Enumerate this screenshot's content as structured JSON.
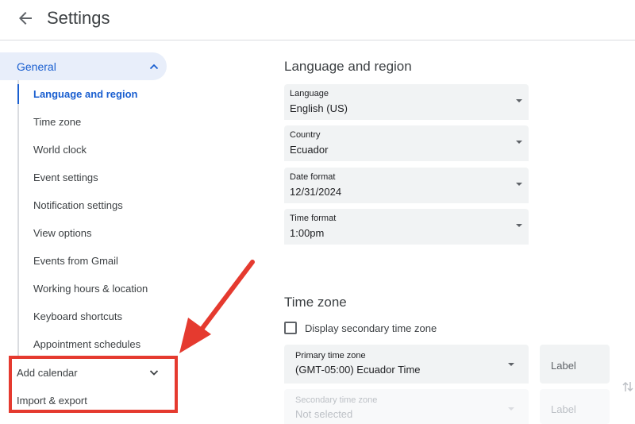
{
  "header": {
    "title": "Settings",
    "back_icon": "arrow-back-icon"
  },
  "sidebar": {
    "general": {
      "label": "General",
      "expanded": true
    },
    "subitems": [
      {
        "label": "Language and region",
        "active": true
      },
      {
        "label": "Time zone"
      },
      {
        "label": "World clock"
      },
      {
        "label": "Event settings"
      },
      {
        "label": "Notification settings"
      },
      {
        "label": "View options"
      },
      {
        "label": "Events from Gmail"
      },
      {
        "label": "Working hours & location"
      },
      {
        "label": "Keyboard shortcuts"
      },
      {
        "label": "Appointment schedules"
      }
    ],
    "add_calendar": "Add calendar",
    "import_export": "Import & export"
  },
  "language_region": {
    "title": "Language and region",
    "fields": [
      {
        "label": "Language",
        "value": "English (US)"
      },
      {
        "label": "Country",
        "value": "Ecuador"
      },
      {
        "label": "Date format",
        "value": "12/31/2024"
      },
      {
        "label": "Time format",
        "value": "1:00pm"
      }
    ]
  },
  "time_zone": {
    "title": "Time zone",
    "secondary_checkbox": "Display secondary time zone",
    "primary": {
      "label": "Primary time zone",
      "value": "(GMT-05:00) Ecuador Time",
      "label_field": "Label"
    },
    "secondary": {
      "label": "Secondary time zone",
      "value": "Not selected",
      "label_field": "Label"
    }
  },
  "annotation": {
    "color": "#e53a2f"
  },
  "colors": {
    "accent": "#1a5fd0",
    "active_bg": "#e8eefa"
  }
}
